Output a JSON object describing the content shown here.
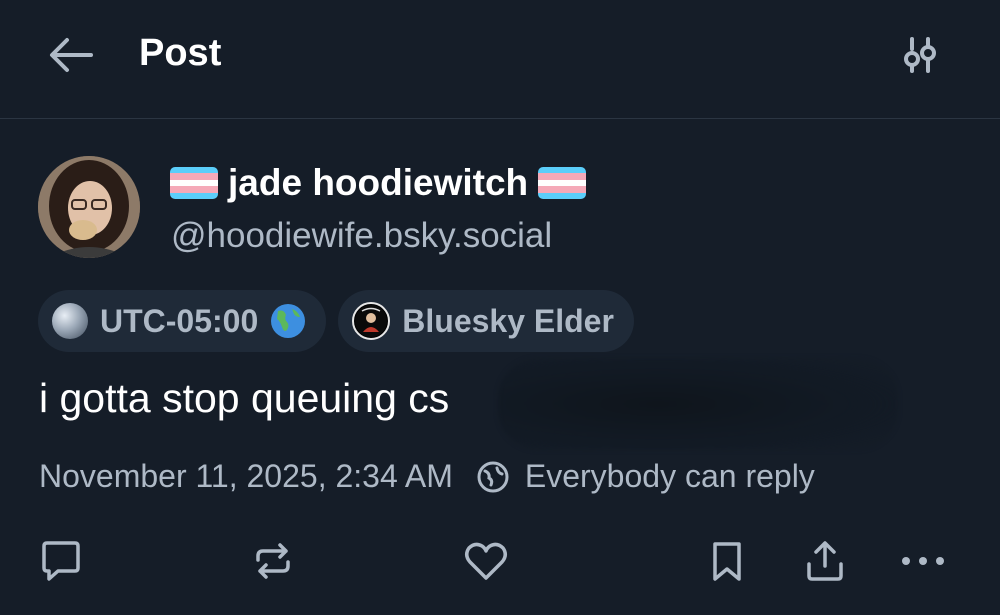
{
  "header": {
    "title": "Post",
    "back_icon": "arrow-left-icon",
    "settings_icon": "sliders-icon"
  },
  "author": {
    "display_name": "jade hoodiewitch",
    "handle": "@hoodiewife.bsky.social",
    "flag_icon": "trans-flag-icon"
  },
  "badges": [
    {
      "label": "UTC-05:00",
      "icon": "globe-icon",
      "trailing_icon": "earth-americas-icon"
    },
    {
      "label": "Bluesky Elder",
      "icon": "bluesky-elder-badge-icon"
    }
  ],
  "post": {
    "text": "i gotta stop queuing cs"
  },
  "meta": {
    "timestamp": "November 11, 2025, 2:34 AM",
    "reply_setting": "Everybody can reply"
  },
  "colors": {
    "background": "#151d28",
    "text_primary": "#f1f3f5",
    "text_secondary": "#aeb9c6",
    "badge_bg": "#1f2a38"
  }
}
